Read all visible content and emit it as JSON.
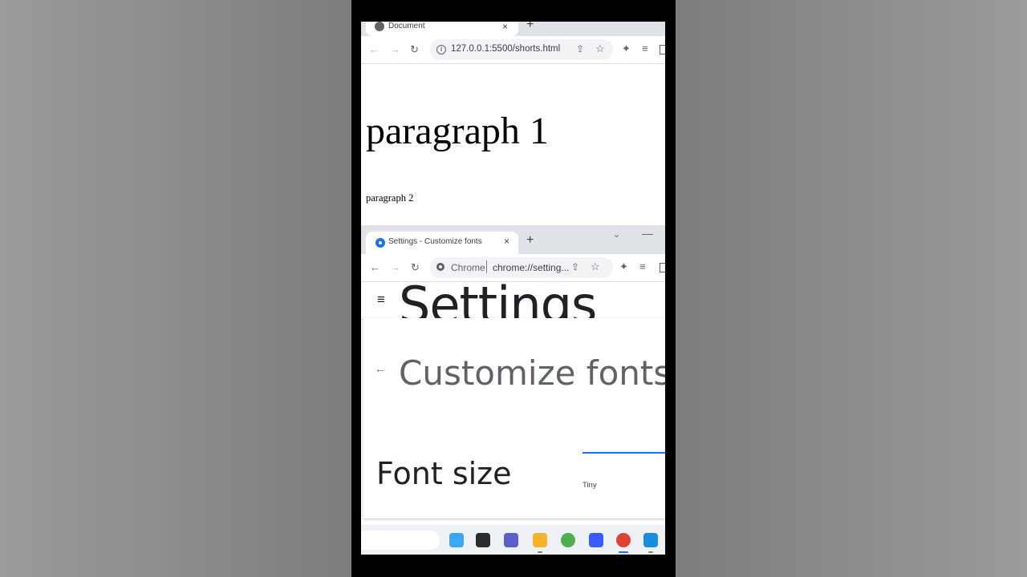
{
  "browser1": {
    "tab_title": "Document",
    "tab_close": "×",
    "new_tab": "+",
    "url": "127.0.0.1:5500/shorts.html",
    "page": {
      "paragraph1": "paragraph 1",
      "paragraph2": "paragraph 2"
    }
  },
  "browser2": {
    "tab_title": "Settings - Customize fonts",
    "tab_close": "×",
    "new_tab": "+",
    "omnibox_chip": "Chrome",
    "url": "chrome://setting...",
    "header_title": "Settings",
    "page_title": "Customize fonts",
    "font_size_label": "Font size",
    "slider_min_label": "Tiny"
  },
  "icons": {
    "back": "←",
    "forward": "→",
    "reload": "↻",
    "star": "☆",
    "share": "⇪",
    "extensions": "✦",
    "media": "≡",
    "hamburger": "≡",
    "chevron": "⌄",
    "minimize": "—",
    "back_arrow": "←"
  },
  "taskbar": {
    "apps": [
      {
        "name": "copilot-icon",
        "color": "#3ba8f5"
      },
      {
        "name": "task-view-icon",
        "color": "#2b2b2b"
      },
      {
        "name": "teams-chat-icon",
        "color": "#5b5fc7"
      },
      {
        "name": "file-explorer-icon",
        "color": "#f4b52a"
      },
      {
        "name": "xbox-icon",
        "color": "#4caf50"
      },
      {
        "name": "network-app-icon",
        "color": "#3d5afe"
      },
      {
        "name": "chrome-icon",
        "color": "#db4437"
      },
      {
        "name": "vscode-icon",
        "color": "#1c8ce0"
      }
    ]
  },
  "colors": {
    "accent": "#1a73e8",
    "tab_strip": "#dfe3e7"
  }
}
